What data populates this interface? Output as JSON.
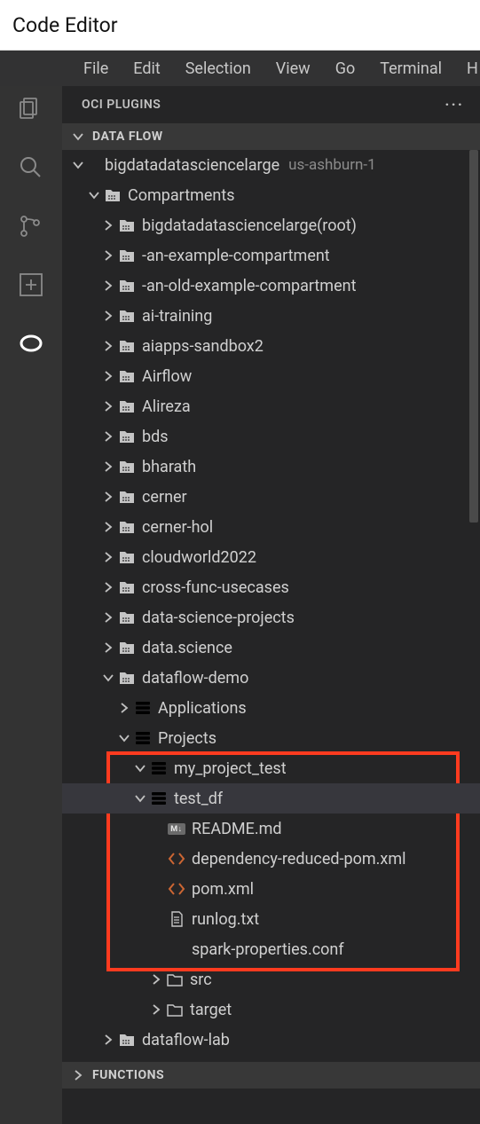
{
  "title": "Code Editor",
  "menubar": [
    "File",
    "Edit",
    "Selection",
    "View",
    "Go",
    "Terminal",
    "H"
  ],
  "panel": {
    "title": "OCI PLUGINS",
    "more": "···"
  },
  "sections": {
    "dataflow": "DATA FLOW",
    "functions": "FUNCTIONS"
  },
  "tenancy": {
    "name": "bigdatadatasciencelarge",
    "region": "us-ashburn-1"
  },
  "compartments_label": "Compartments",
  "compartments": [
    "bigdatadatasciencelarge(root)",
    "-an-example-compartment",
    "-an-old-example-compartment",
    "ai-training",
    "aiapps-sandbox2",
    "Airflow",
    "Alireza",
    "bds",
    "bharath",
    "cerner",
    "cerner-hol",
    "cloudworld2022",
    "cross-func-usecases",
    "data-science-projects",
    "data.science"
  ],
  "dataflow_demo": "dataflow-demo",
  "apps_label": "Applications",
  "projects_label": "Projects",
  "project1": "my_project_test",
  "project2": "test_df",
  "files": {
    "readme": "README.md",
    "dep_pom": "dependency-reduced-pom.xml",
    "pom": "pom.xml",
    "runlog": "runlog.txt",
    "spark": "spark-properties.conf"
  },
  "folders": {
    "src": "src",
    "target": "target"
  },
  "dataflow_lab": "dataflow-lab",
  "md_badge": "M↓"
}
